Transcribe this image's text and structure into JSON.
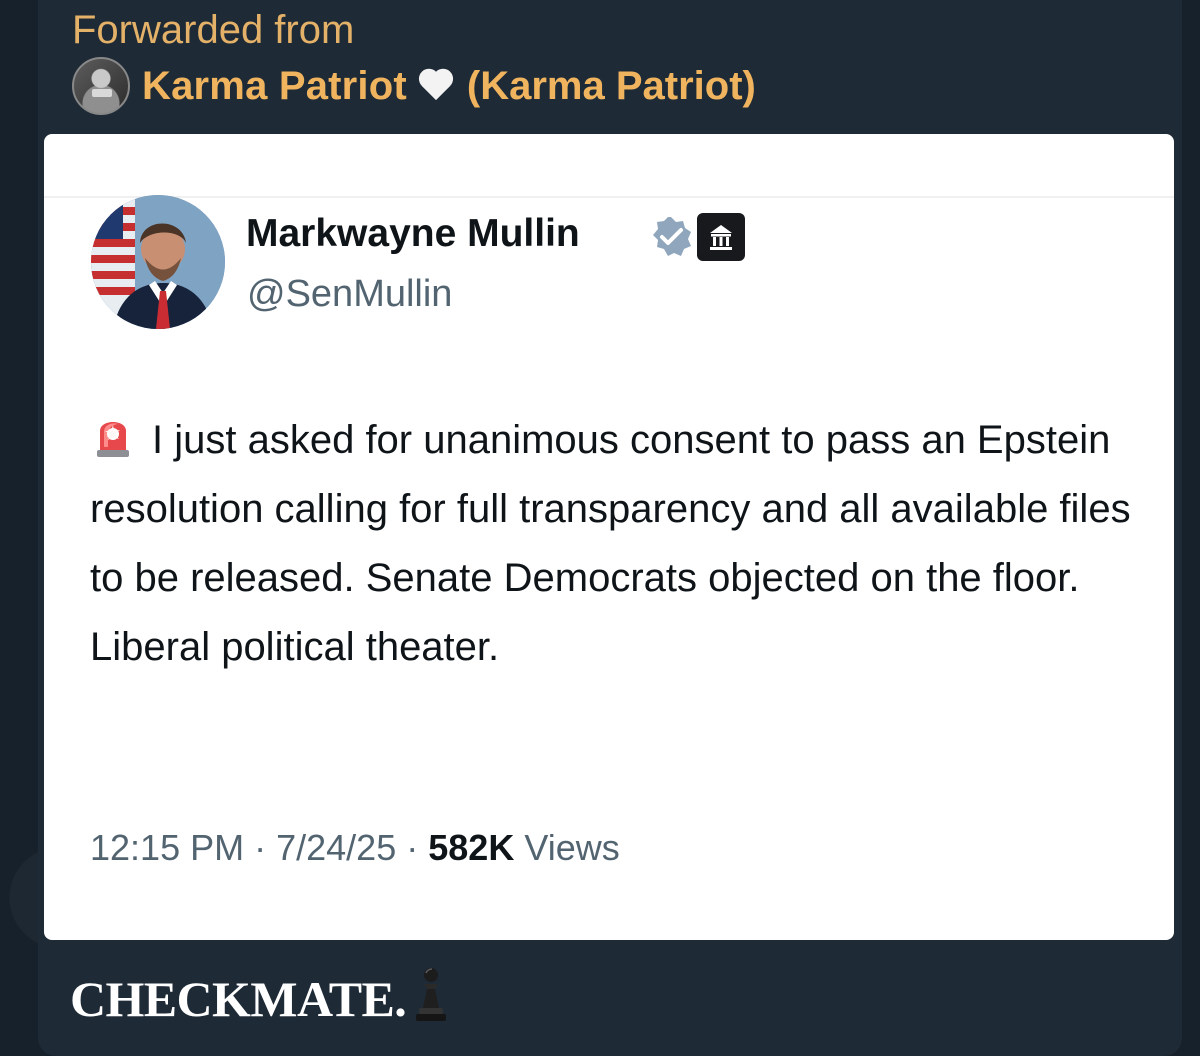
{
  "forward": {
    "label": "Forwarded from",
    "source_name": "Karma Patriot",
    "source_handle": "(Karma Patriot)",
    "heart_icon": "white-heart-icon"
  },
  "tweet": {
    "author_name": "Markwayne Mullin",
    "author_handle": "@SenMullin",
    "verified_icon": "verified-badge-icon",
    "affiliation_icon": "government-building-icon",
    "emoji_icon": "siren-icon",
    "text": "I just asked for unanimous consent to pass an Epstein resolution calling for full transparency and all available files to be released. Senate Democrats objected on the floor. Liberal political theater.",
    "time": "12:15 PM",
    "date": "7/24/25",
    "views_count": "582K",
    "views_label": "Views"
  },
  "caption": {
    "text": "CHECKMATE.",
    "icon": "pawn-icon"
  },
  "colors": {
    "forward_accent": "#e4b169",
    "tweet_text": "#0f1419",
    "tweet_secondary": "#536471",
    "verified": "#8fa6bd"
  }
}
